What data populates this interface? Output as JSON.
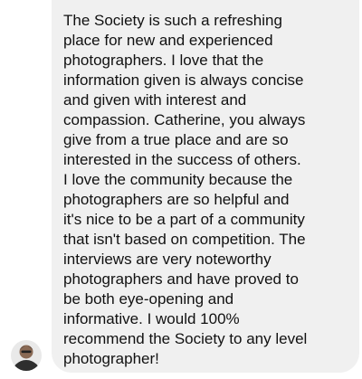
{
  "conversation": {
    "message": {
      "lines": [
        "The Society is such a refreshing",
        "place for new and experienced",
        "photographers. I love that the",
        "information given is always concise",
        "and given with interest and",
        "compassion. Catherine, you always",
        "give from a true place and are so",
        "interested in the success of others.",
        "I love the community because the",
        "photographers are so helpful and",
        "it's nice to be a part of a community",
        "that isn't based on competition. The",
        "interviews are very noteworthy",
        "photographers and have proved to",
        "be both eye-opening and",
        "informative. I would 100%",
        "recommend the Society to any level",
        "photographer!"
      ]
    }
  },
  "colors": {
    "bubble_background": "#f0f0f0",
    "text": "#111111",
    "page_background": "#ffffff"
  },
  "icons": {
    "avatar": "sender-avatar"
  }
}
